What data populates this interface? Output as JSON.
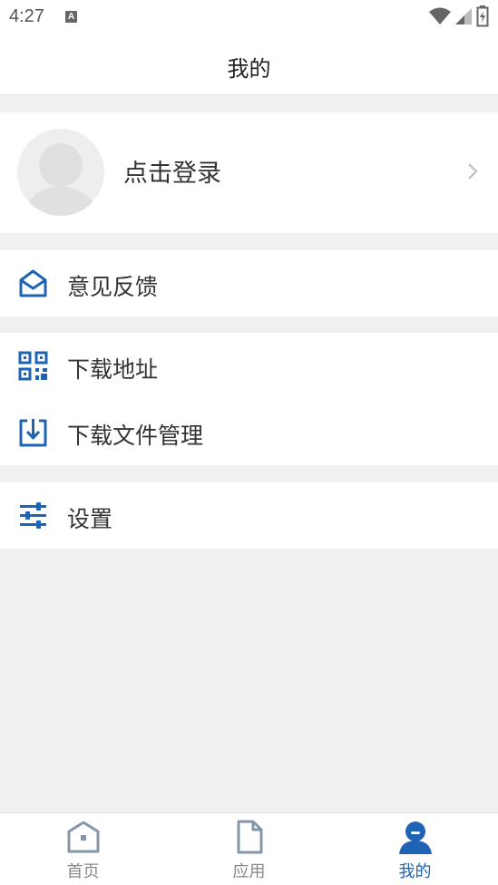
{
  "status_bar": {
    "time": "4:27",
    "notification_letter": "A"
  },
  "header": {
    "title": "我的"
  },
  "profile": {
    "login_label": "点击登录"
  },
  "menu": {
    "feedback": "意见反馈",
    "download_address": "下载地址",
    "download_manager": "下载文件管理",
    "settings": "设置"
  },
  "tabs": [
    {
      "label": "首页",
      "icon": "home-icon",
      "active": false
    },
    {
      "label": "应用",
      "icon": "document-icon",
      "active": false
    },
    {
      "label": "我的",
      "icon": "user-icon",
      "active": true
    }
  ],
  "colors": {
    "accent": "#1f64b4",
    "inactive_icon": "#8496a9",
    "background": "#f0f0f0"
  }
}
